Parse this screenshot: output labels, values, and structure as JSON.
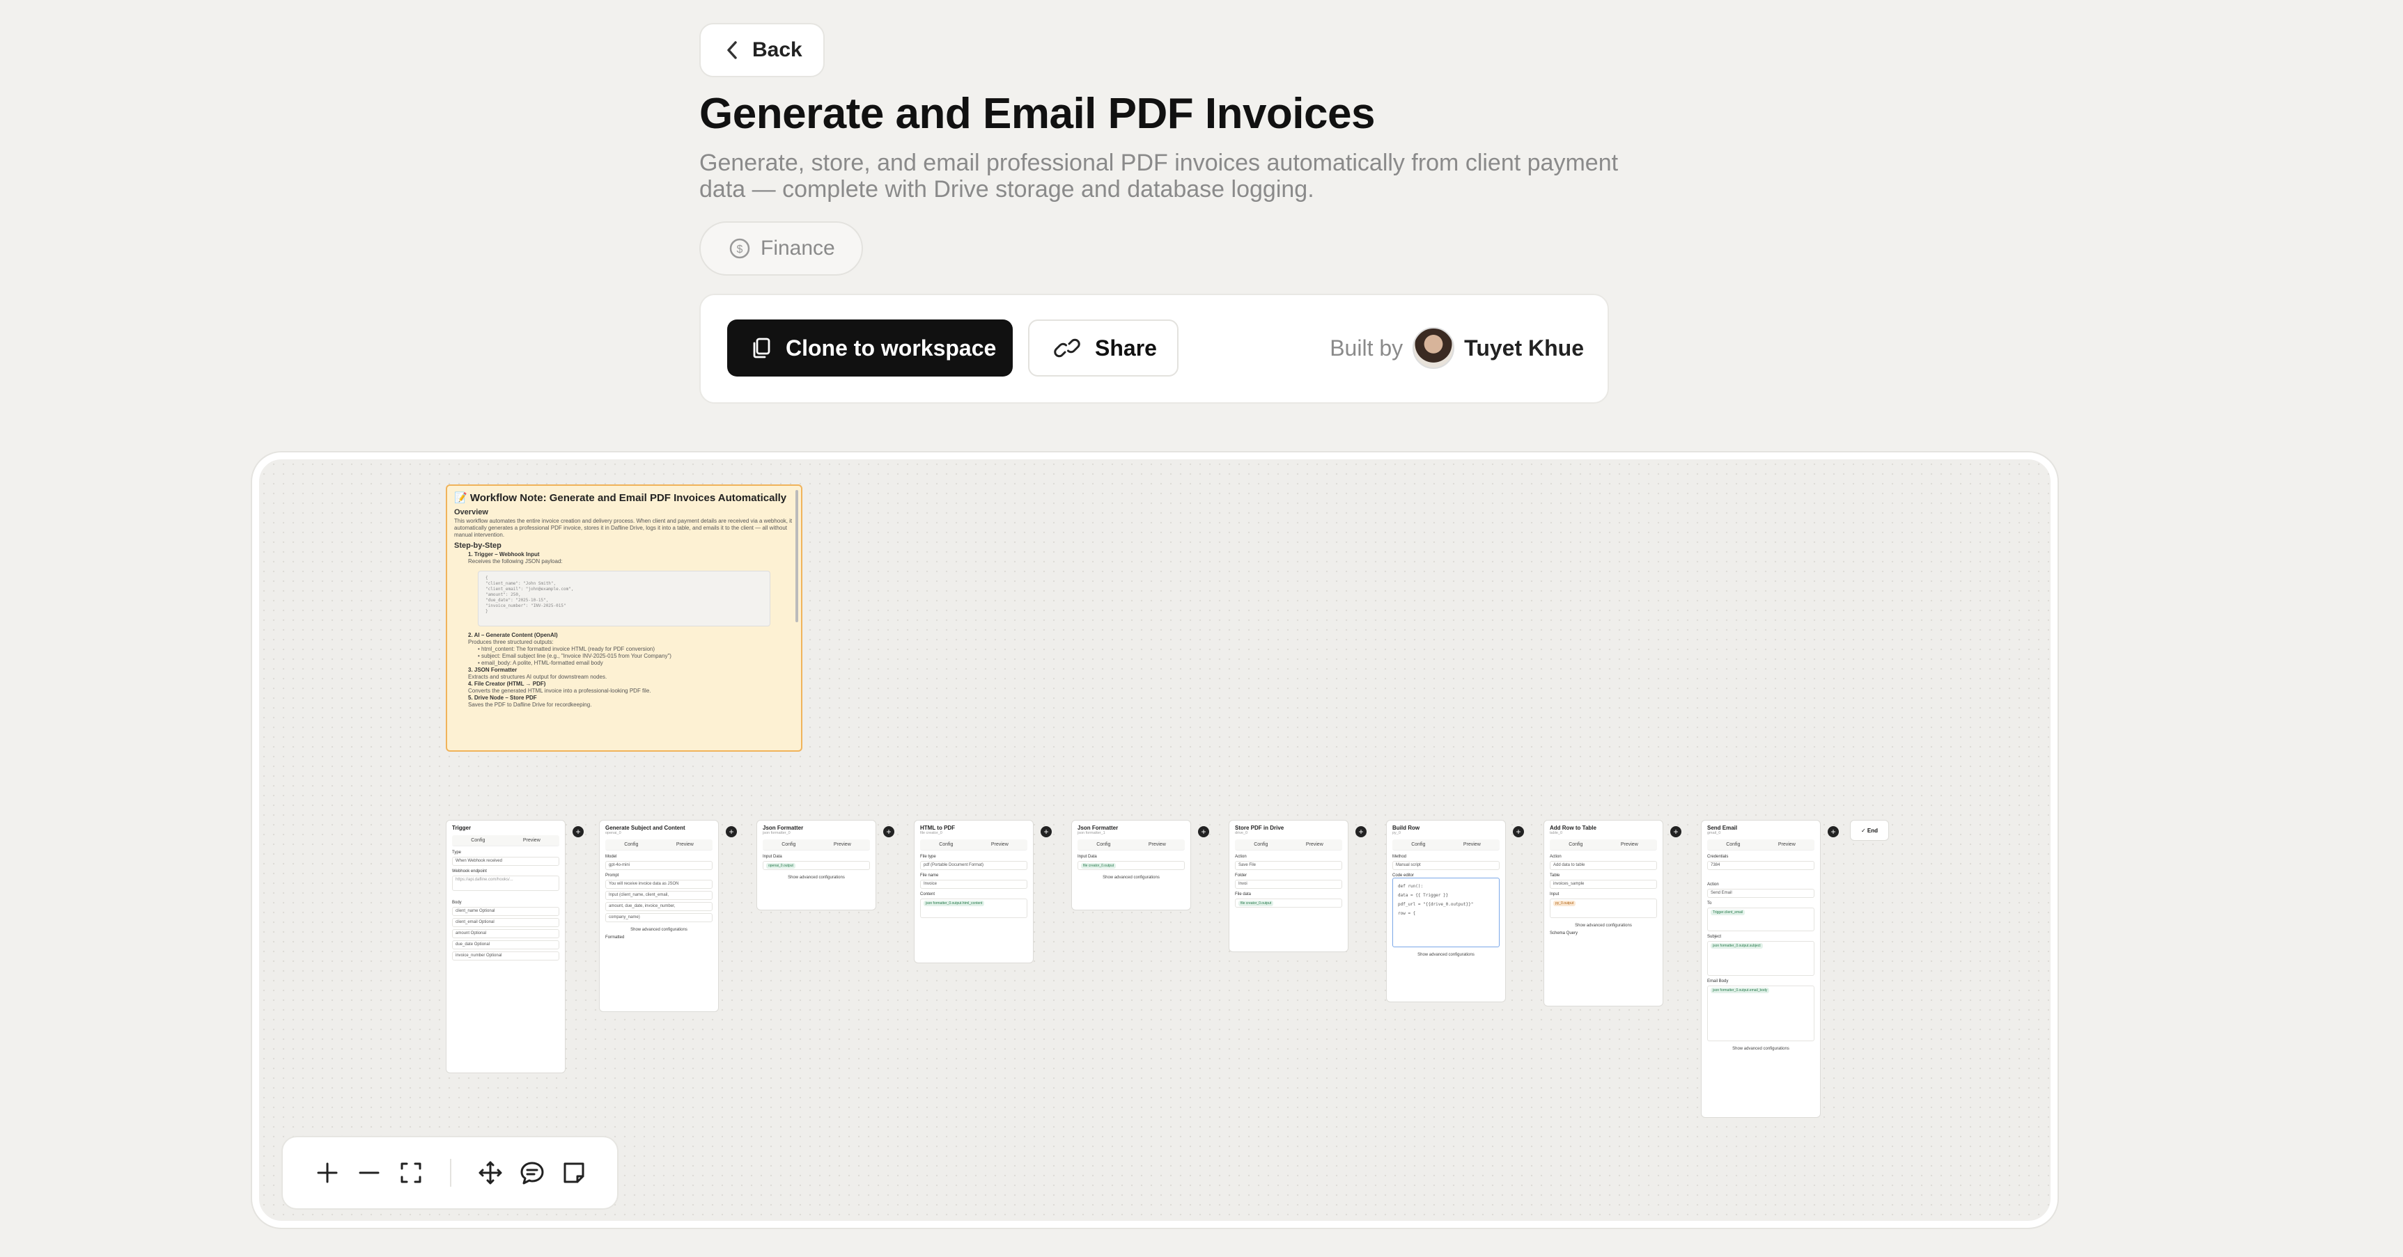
{
  "header": {
    "back_label": "Back",
    "title": "Generate and Email PDF Invoices",
    "description": "Generate, store, and email professional PDF invoices automatically from client payment data — complete with Drive storage and database logging.",
    "tag": "Finance"
  },
  "actions": {
    "clone_label": "Clone to workspace",
    "share_label": "Share",
    "built_by_label": "Built by",
    "author": "Tuyet Khue"
  },
  "note": {
    "title": "Workflow Note: Generate and Email PDF Invoices Automatically",
    "overview_heading": "Overview",
    "overview_text": "This workflow automates the entire invoice creation and delivery process. When client and payment details are received via a webhook, it automatically generates a professional PDF invoice, stores it in Dafline Drive, logs it into a table, and emails it to the client — all without manual intervention.",
    "steps_heading": "Step-by-Step",
    "step1": "1. Trigger – Webhook Input",
    "step1_text": "Receives the following JSON payload:",
    "code": [
      "{",
      "\"client_name\": \"John Smith\",",
      "\"client_email\": \"john@example.com\",",
      "\"amount\": 250,",
      "\"due_date\": \"2025-10-15\",",
      "\"invoice_number\": \"INV-2025-015\"",
      "}"
    ],
    "step2": "2. AI – Generate Content (OpenAI)",
    "step2_text": "Produces three structured outputs:",
    "bullets": [
      "• html_content: The formatted invoice HTML (ready for PDF conversion)",
      "• subject: Email subject line (e.g., \"Invoice INV-2025-015 from Your Company\")",
      "• email_body: A polite, HTML-formatted email body"
    ],
    "step3": "3. JSON Formatter",
    "step3_text": "Extracts and structures AI output for downstream nodes.",
    "step4": "4. File Creator (HTML → PDF)",
    "step4_text": "Converts the generated HTML invoice into a professional-looking PDF file.",
    "step5": "5. Drive Node – Store PDF",
    "step5_text": "Saves the PDF to Dafline Drive for recordkeeping."
  },
  "nodes": [
    {
      "title": "Trigger",
      "sub": "",
      "tab1": "Config",
      "tab2": "Preview",
      "l1": "Type",
      "v1": "When Webhook received",
      "l2": "Webhook endpoint",
      "v2": "https://api.dafline.com/hooks/...",
      "l3": "Body",
      "v3": "client_name  Optional",
      "v4": "client_email  Optional",
      "v5": "amount  Optional",
      "v6": "due_date  Optional",
      "v7": "invoice_number  Optional"
    },
    {
      "title": "Generate Subject and Content",
      "sub": "openai_0",
      "tab1": "Config",
      "tab2": "Preview",
      "l1": "Model",
      "v1": "gpt-4o-mini",
      "l2": "Prompt",
      "v2": "You will receive invoice data as JSON",
      "v3": "Input (client_name, client_email,",
      "v4": "amount, due_date, invoice_number,",
      "v5": "company_name)",
      "adv": "Show advanced configurations",
      "l3": "Formatted"
    },
    {
      "title": "Json Formatter",
      "sub": "json formatter_0",
      "tab1": "Config",
      "tab2": "Preview",
      "l1": "Input Data",
      "v1": "openai_0.output",
      "adv": "Show advanced configurations"
    },
    {
      "title": "HTML to PDF",
      "sub": "file creator_0",
      "tab1": "Config",
      "tab2": "Preview",
      "l1": "File type",
      "v1": "pdf (Portable Document Format)",
      "l2": "File name",
      "v2": "Invoice",
      "l3": "Content",
      "v3": "json formatter_0.output.html_content"
    },
    {
      "title": "Json Formatter",
      "sub": "json formatter_1",
      "tab1": "Config",
      "tab2": "Preview",
      "l1": "Input Data",
      "v1": "file creator_0.output",
      "adv": "Show advanced configurations"
    },
    {
      "title": "Store PDF in Drive",
      "sub": "drive_0",
      "tab1": "Config",
      "tab2": "Preview",
      "l1": "Action",
      "v1": "Save File",
      "l2": "Folder",
      "v2": "Invoi",
      "l3": "File data",
      "v3": "file creator_0.output"
    },
    {
      "title": "Build Row",
      "sub": "py_0",
      "tab1": "Config",
      "tab2": "Preview",
      "l1": "Method",
      "v1": "Manual script",
      "l2": "Code editor",
      "v2": "def run():",
      "v3": "data = {{ Trigger }}",
      "v4": "pdf_url = \"{{drive_0.output}}\"",
      "v5": "row = {",
      "adv": "Show advanced configurations"
    },
    {
      "title": "Add Row to Table",
      "sub": "table_0",
      "tab1": "Config",
      "tab2": "Preview",
      "l1": "Action",
      "v1": "Add data to table",
      "l2": "Table",
      "v2": "invoices_sample",
      "l3": "Input",
      "v3": "py_0.output",
      "adv": "Show advanced configurations",
      "v4": "Schema  Query"
    },
    {
      "title": "Send Email",
      "sub": "gmail_0",
      "tab1": "Config",
      "tab2": "Preview",
      "l1": "Credentials",
      "v1": "7384",
      "l2": "Action",
      "v2": "Send Email",
      "l3": "To",
      "v3": "Trigger.client_email",
      "v4": "Subject",
      "v5": "json formatter_0.output.subject",
      "v6": "Email Body",
      "v7": "json formatter_0.output.email_body",
      "adv": "Show advanced configurations"
    }
  ],
  "end_label": "✓ End",
  "icons": {
    "back": "chevron-left-icon",
    "tag": "dollar-circle-icon",
    "clone": "copy-icon",
    "share": "link-icon",
    "zoom_in": "plus-icon",
    "zoom_out": "minus-icon",
    "fit": "fit-view-icon",
    "pan": "move-icon",
    "comment": "comment-icon",
    "note": "sticky-note-icon"
  }
}
